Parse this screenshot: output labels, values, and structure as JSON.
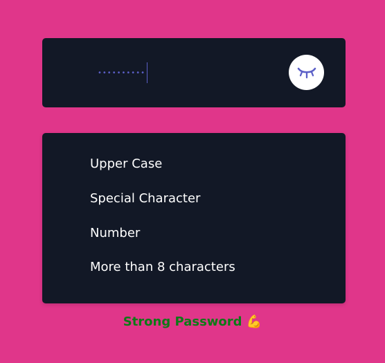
{
  "password": {
    "masked_value": "••••••••••",
    "toggle_icon": "eye-closed-icon"
  },
  "requirements": {
    "items": [
      {
        "label": "Upper Case"
      },
      {
        "label": "Special Character"
      },
      {
        "label": "Number"
      },
      {
        "label": "More than 8 characters"
      }
    ]
  },
  "strength": {
    "label": "Strong Password",
    "emoji": "💪",
    "color": "#0c7a16"
  },
  "colors": {
    "background": "#e0368a",
    "card": "#121826",
    "accent": "#5b5fc7"
  }
}
